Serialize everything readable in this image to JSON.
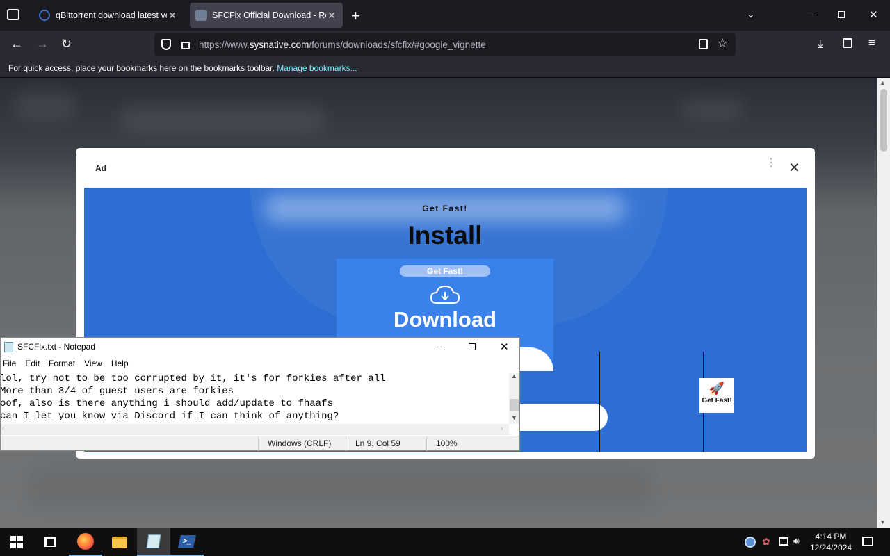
{
  "browser": {
    "tabs": [
      {
        "title": "qBittorrent download latest version",
        "active": false
      },
      {
        "title": "SFCFix Official Download - Repair",
        "active": true
      }
    ],
    "url": {
      "prefix": "https://www.",
      "host": "sysnative.com",
      "path": "/forums/downloads/sfcfix/#google_vignette"
    },
    "bookmarks_message": "For quick access, place your bookmarks here on the bookmarks toolbar.",
    "manage_bookmarks": "Manage bookmarks..."
  },
  "ad": {
    "label": "Ad",
    "tagline": "Get Fast!",
    "headline": "Install",
    "pill": "Get Fast!",
    "cta": "Download",
    "tile_label": "Get Fast!"
  },
  "notepad": {
    "title": "SFCFix.txt - Notepad",
    "menu": [
      "File",
      "Edit",
      "Format",
      "View",
      "Help"
    ],
    "lines": [
      "lol, try not to be too corrupted by it, it's for forkies after all",
      "More than 3/4 of guest users are forkies",
      "oof, also is there anything i should add/update to fhaafs",
      "can I let you know via Discord if I can think of anything?"
    ],
    "status": {
      "encoding": "Windows (CRLF)",
      "position": "Ln 9, Col 59",
      "zoom": "100%"
    }
  },
  "taskbar": {
    "time": "4:14 PM",
    "date": "12/24/2024"
  },
  "colors": {
    "accent": "#2d6ed3",
    "link": "#80ebff"
  }
}
